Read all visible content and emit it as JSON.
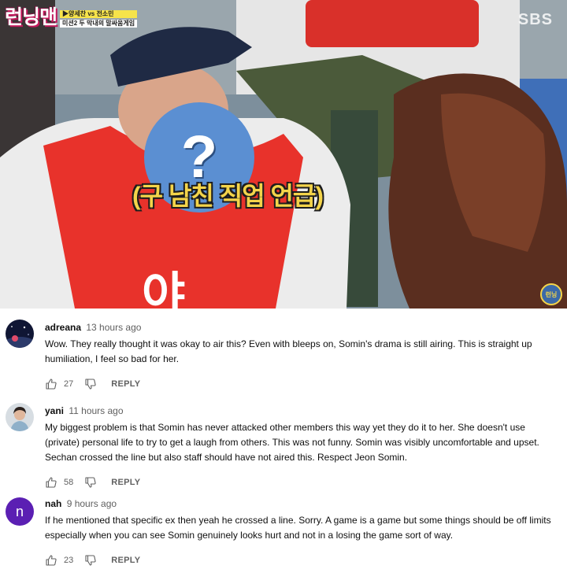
{
  "video": {
    "show_logo": "런닝맨",
    "subtitle_line1": "▶양세찬 vs 전소민",
    "subtitle_line2": "미션2 두 막내의 말싸움게임",
    "broadcaster": "SBS",
    "face_mark": "?",
    "caption": "(구 남친 직업 언급)",
    "bib_text": "야",
    "corner_badge": "런닝"
  },
  "colors": {
    "bib_red": "#e8322b",
    "blur_blue": "#5b8fd2",
    "caption_yellow": "#f4d44a",
    "avatar_purple": "#5b1fb3"
  },
  "comments": [
    {
      "author": "adreana",
      "time": "13 hours ago",
      "text": "Wow. They really thought it was okay to air this? Even with bleeps on, Somin's drama is still airing. This is straight up humiliation, I feel so bad for her.",
      "likes": "27",
      "reply_label": "REPLY",
      "avatar_icon": "night-sky-avatar"
    },
    {
      "author": "yani",
      "time": "11 hours ago",
      "text": "My biggest problem is that Somin has never attacked other members this way yet they do it to her. She doesn't use (private) personal life to try to get a laugh from others. This was not funny. Somin was visibly uncomfortable and upset. Sechan crossed the line but also staff should have not aired this. Respect Jeon Somin.",
      "likes": "58",
      "reply_label": "REPLY",
      "avatar_icon": "photo-avatar"
    },
    {
      "author": "nah",
      "time": "9 hours ago",
      "text": "If he mentioned that specific ex then yeah he crossed a line. Sorry. A game is a game but some things should be off limits especially when you can see Somin genuinely looks hurt and not in a losing the game sort of way.",
      "likes": "23",
      "reply_label": "REPLY",
      "avatar_letter": "n"
    }
  ]
}
